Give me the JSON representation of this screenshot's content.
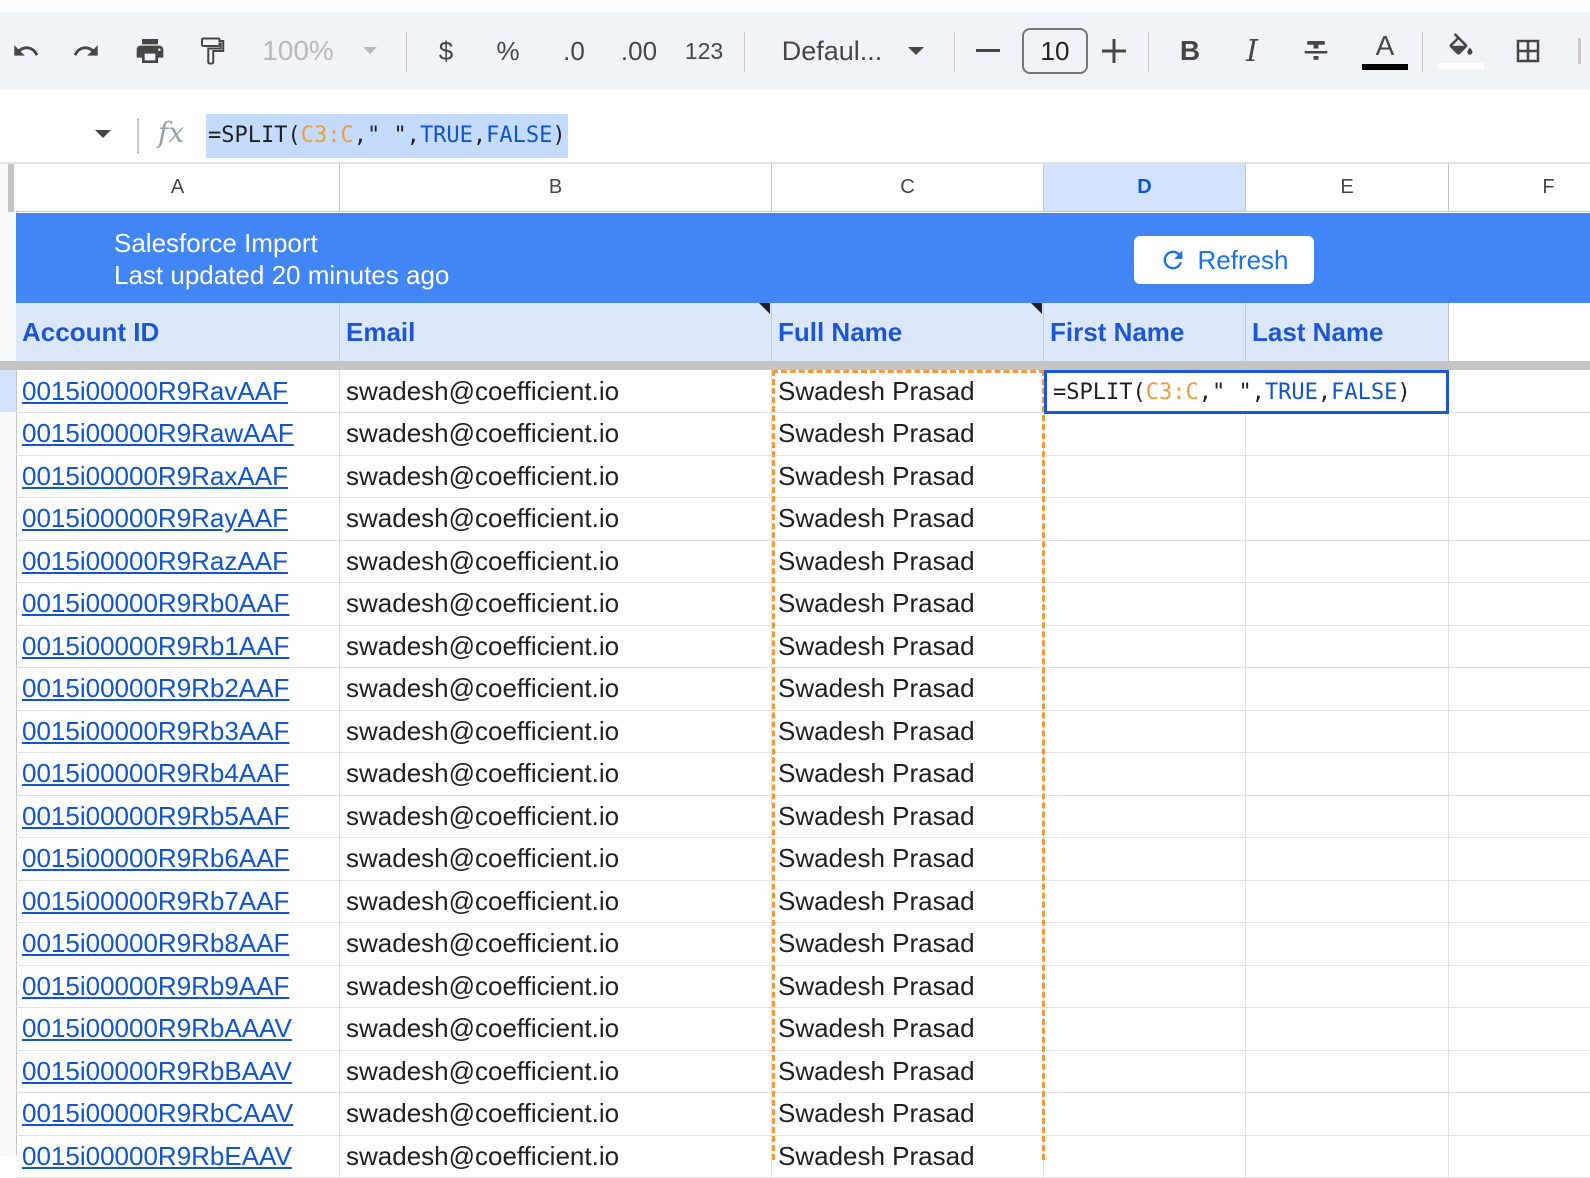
{
  "toolbar": {
    "zoom": "100%",
    "currency": "$",
    "percent": "%",
    "dec_decrease": ".0",
    "dec_increase": ".00",
    "number_format": "123",
    "font_name": "Defaul...",
    "font_size": "10",
    "bold": "B",
    "italic": "I",
    "text_color_letter": "A"
  },
  "formula_bar": {
    "fx_label": "fx",
    "formula_prefix": "=SPLIT(",
    "formula_ref": "C3:C",
    "formula_mid": ",\" \",",
    "formula_true": "TRUE",
    "formula_comma": ",",
    "formula_false": "FALSE",
    "formula_suffix": ")"
  },
  "columns": [
    "A",
    "B",
    "C",
    "D",
    "E",
    "F"
  ],
  "selected_column": "D",
  "banner": {
    "title": "Salesforce Import",
    "subtitle": "Last updated 20 minutes ago",
    "refresh_label": "Refresh"
  },
  "headers": {
    "account_id": "Account ID",
    "email": "Email",
    "full_name": "Full Name",
    "first_name": "First Name",
    "last_name": "Last Name"
  },
  "rows": [
    {
      "id": "0015i00000R9RavAAF",
      "email": "swadesh@coefficient.io",
      "name": "Swadesh Prasad"
    },
    {
      "id": "0015i00000R9RawAAF",
      "email": "swadesh@coefficient.io",
      "name": "Swadesh Prasad"
    },
    {
      "id": "0015i00000R9RaxAAF",
      "email": "swadesh@coefficient.io",
      "name": "Swadesh Prasad"
    },
    {
      "id": "0015i00000R9RayAAF",
      "email": "swadesh@coefficient.io",
      "name": "Swadesh Prasad"
    },
    {
      "id": "0015i00000R9RazAAF",
      "email": "swadesh@coefficient.io",
      "name": "Swadesh Prasad"
    },
    {
      "id": "0015i00000R9Rb0AAF",
      "email": "swadesh@coefficient.io",
      "name": "Swadesh Prasad"
    },
    {
      "id": "0015i00000R9Rb1AAF",
      "email": "swadesh@coefficient.io",
      "name": "Swadesh Prasad"
    },
    {
      "id": "0015i00000R9Rb2AAF",
      "email": "swadesh@coefficient.io",
      "name": "Swadesh Prasad"
    },
    {
      "id": "0015i00000R9Rb3AAF",
      "email": "swadesh@coefficient.io",
      "name": "Swadesh Prasad"
    },
    {
      "id": "0015i00000R9Rb4AAF",
      "email": "swadesh@coefficient.io",
      "name": "Swadesh Prasad"
    },
    {
      "id": "0015i00000R9Rb5AAF",
      "email": "swadesh@coefficient.io",
      "name": "Swadesh Prasad"
    },
    {
      "id": "0015i00000R9Rb6AAF",
      "email": "swadesh@coefficient.io",
      "name": "Swadesh Prasad"
    },
    {
      "id": "0015i00000R9Rb7AAF",
      "email": "swadesh@coefficient.io",
      "name": "Swadesh Prasad"
    },
    {
      "id": "0015i00000R9Rb8AAF",
      "email": "swadesh@coefficient.io",
      "name": "Swadesh Prasad"
    },
    {
      "id": "0015i00000R9Rb9AAF",
      "email": "swadesh@coefficient.io",
      "name": "Swadesh Prasad"
    },
    {
      "id": "0015i00000R9RbAAAV",
      "email": "swadesh@coefficient.io",
      "name": "Swadesh Prasad"
    },
    {
      "id": "0015i00000R9RbBAAV",
      "email": "swadesh@coefficient.io",
      "name": "Swadesh Prasad"
    },
    {
      "id": "0015i00000R9RbCAAV",
      "email": "swadesh@coefficient.io",
      "name": "Swadesh Prasad"
    },
    {
      "id": "0015i00000R9RbEAAV",
      "email": "swadesh@coefficient.io",
      "name": "Swadesh Prasad"
    }
  ],
  "colors": {
    "banner": "#4285f4",
    "header_fill": "#dbe8fb",
    "header_text": "#1a56d6",
    "link": "#1155cc",
    "copy_outline": "#f29b39"
  }
}
